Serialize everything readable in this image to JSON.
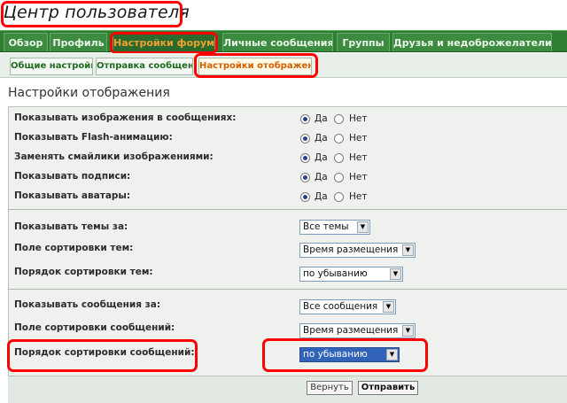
{
  "header": {
    "title": "Центр пользователя"
  },
  "main_nav": {
    "tabs": [
      {
        "label": "Обзор"
      },
      {
        "label": "Профиль"
      },
      {
        "label": "Настройки форума",
        "active": true
      },
      {
        "label": "Личные сообщения"
      },
      {
        "label": "Группы"
      },
      {
        "label": "Друзья и недоброжелатели"
      }
    ]
  },
  "sub_nav": {
    "tabs": [
      {
        "label": "Общие настройки"
      },
      {
        "label": "Отправка сообщений"
      },
      {
        "label": "Настройки отображения",
        "active": true
      }
    ]
  },
  "panel": {
    "title": "Настройки отображения",
    "yes_label": "Да",
    "no_label": "Нет",
    "radio_rows": [
      {
        "label": "Показывать изображения в сообщениях:",
        "value": "yes"
      },
      {
        "label": "Показывать Flash-анимацию:",
        "value": "yes"
      },
      {
        "label": "Заменять смайлики изображениями:",
        "value": "yes"
      },
      {
        "label": "Показывать подписи:",
        "value": "yes"
      },
      {
        "label": "Показывать аватары:",
        "value": "yes"
      }
    ],
    "topic_rows": [
      {
        "label": "Показывать темы за:",
        "value": "Все темы"
      },
      {
        "label": "Поле сортировки тем:",
        "value": "Время размещения"
      },
      {
        "label": "Порядок сортировки тем:",
        "value": "по убыванию"
      }
    ],
    "post_rows": [
      {
        "label": "Показывать сообщения за:",
        "value": "Все сообщения"
      },
      {
        "label": "Поле сортировки сообщений:",
        "value": "Время размещения"
      },
      {
        "label": "Порядок сортировки сообщений:",
        "value": "по убыванию"
      }
    ]
  },
  "footer": {
    "reset_label": "Вернуть",
    "submit_label": "Отправить"
  },
  "colors": {
    "nav_green": "#2e7d32",
    "active_tab_text": "#f0a030",
    "active_subtab_text": "#d35f00",
    "highlight_red": "#ff0000",
    "focused_select": "#3163b8"
  }
}
